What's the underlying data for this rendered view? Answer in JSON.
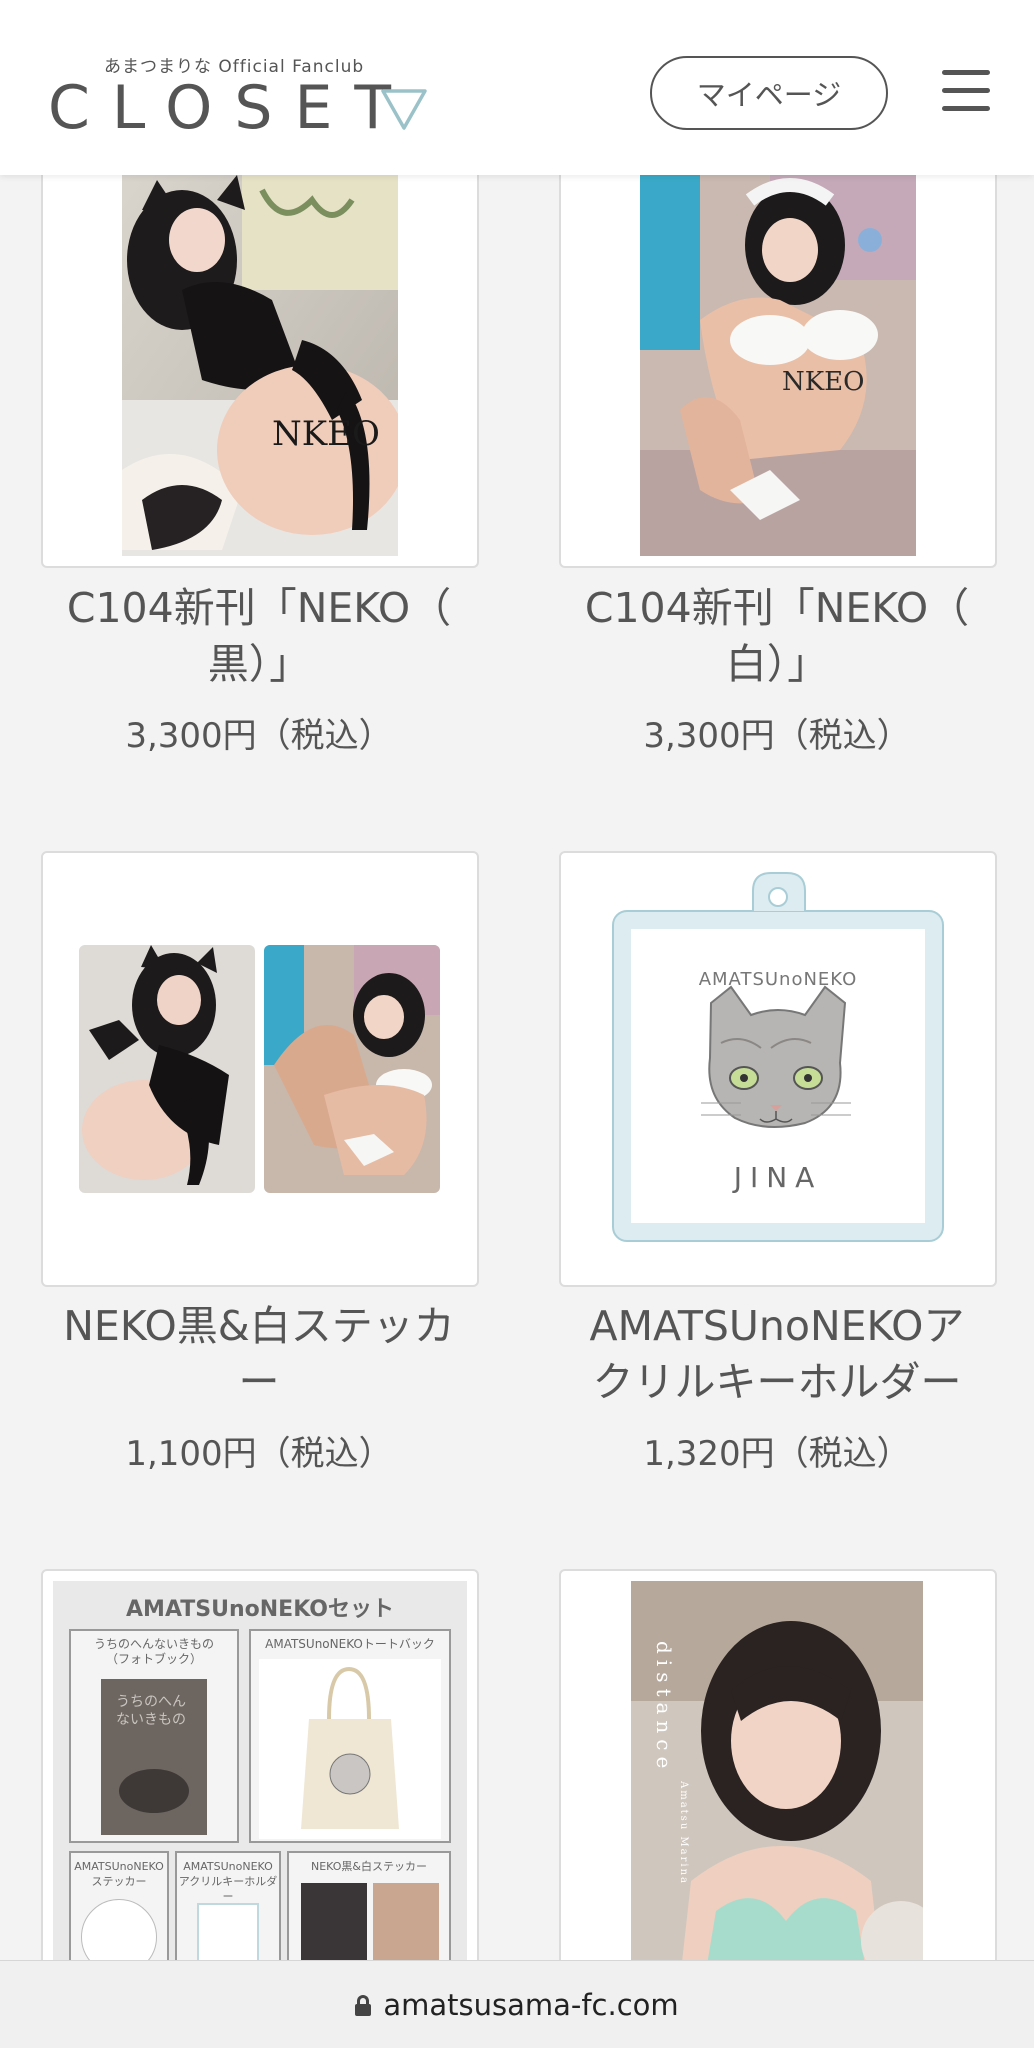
{
  "header": {
    "logo_subtitle": "あまつまりな Official Fanclub",
    "logo_title": "CLOSET",
    "mypage_label": "マイページ",
    "menu_icon": "hamburger-menu-icon"
  },
  "products": [
    {
      "name_line1": "C104新刊「NEKO（",
      "name_line2": "黒）」",
      "price": "3,300円（税込）"
    },
    {
      "name_line1": "C104新刊「NEKO（",
      "name_line2": "白）」",
      "price": "3,300円（税込）"
    },
    {
      "name_line1": "NEKO黒&白ステッカ",
      "name_line2": "ー",
      "price": "1,100円（税込）"
    },
    {
      "name_line1": "AMATSUnoNEKOア",
      "name_line2": "クリルキーホルダー",
      "price": "1,320円（税込）"
    }
  ],
  "keychain_art": {
    "caption_top": "AMATSUnoNEKO",
    "caption_bottom": "JINA"
  },
  "photo_text": {
    "neko_logo": "NKEO"
  },
  "set_card": {
    "title": "AMATSUnoNEKOセット",
    "photobook_label_1": "うちのへんないきもの",
    "photobook_label_2": "（フォトブック）",
    "photobook_cover_text": "うちのへんないきもの",
    "tote_label": "AMATSUnoNEKOトートバック",
    "sticker_label_1": "AMATSUnoNEKO",
    "sticker_label_2": "ステッカー",
    "acrylic_label_1": "AMATSUnoNEKO",
    "acrylic_label_2": "アクリルキーホルダー",
    "neko_sticker_label": "NEKO黒&白ステッカー"
  },
  "photobook_card": {
    "title_vertical": "distance",
    "subtitle_vertical": "Amatsu Marina"
  },
  "urlbar": {
    "url": "amatsusama-fc.com",
    "lock_icon": "lock-icon"
  }
}
